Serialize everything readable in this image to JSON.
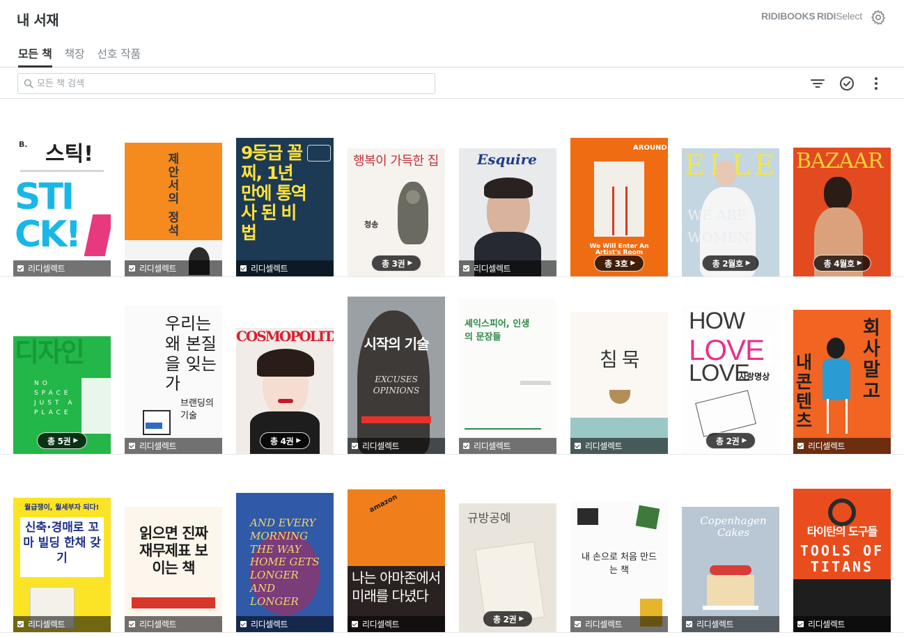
{
  "header": {
    "title": "내 서재",
    "brand_ridibooks": "RIDIBOOKS",
    "brand_ridi": "RIDI",
    "brand_select": "Select"
  },
  "tabs": [
    {
      "label": "모든 책",
      "active": true
    },
    {
      "label": "책장",
      "active": false
    },
    {
      "label": "선호 작품",
      "active": false
    }
  ],
  "search": {
    "placeholder": "모든 책 검색",
    "value": ""
  },
  "icons": {
    "settings": "gear-icon",
    "filter": "filter-icon",
    "select": "check-circle-icon",
    "more": "more-vertical-icon",
    "search": "search-icon"
  },
  "badge_label": "리디셀렉트",
  "books": [
    {
      "badge": "리디셀렉트",
      "count": "",
      "cover_text": "스틱!",
      "cover_sub": "STICK!"
    },
    {
      "badge": "리디셀렉트",
      "count": "",
      "cover_text": "제안서의 정석",
      "cover_sub": ""
    },
    {
      "badge": "리디셀렉트",
      "count": "",
      "cover_text": "9등급 꼴찌, 1년 만에 통역사 된 비법",
      "cover_sub": ""
    },
    {
      "badge": "",
      "count": "총 3권",
      "cover_text": "행복이 가득한 집",
      "cover_sub": "청송"
    },
    {
      "badge": "리디셀렉트",
      "count": "",
      "cover_text": "Esquire",
      "cover_sub": ""
    },
    {
      "badge": "",
      "count": "총 3호",
      "cover_text": "AROUND",
      "cover_sub": "We Will Enter An Artist's Room"
    },
    {
      "badge": "",
      "count": "총 2월호",
      "cover_text": "ELLE",
      "cover_sub": "WE ARE WOMEN"
    },
    {
      "badge": "",
      "count": "총 4월호",
      "cover_text": "BAZAAR",
      "cover_sub": ""
    },
    {
      "badge": "",
      "count": "총 5권",
      "cover_text": "디자인",
      "cover_sub": "NO SPACE JUST A PLACE"
    },
    {
      "badge": "리디셀렉트",
      "count": "",
      "cover_text": "우리는 왜 본질을 잊는가",
      "cover_sub": "브랜딩의 기술"
    },
    {
      "badge": "",
      "count": "총 4권",
      "cover_text": "COSMOPOLITAN",
      "cover_sub": ""
    },
    {
      "badge": "리디셀렉트",
      "count": "",
      "cover_text": "시작의 기술",
      "cover_sub": "EXCUSES OPINIONS"
    },
    {
      "badge": "리디셀렉트",
      "count": "",
      "cover_text": "셰익스피어, 인생의 문장들",
      "cover_sub": ""
    },
    {
      "badge": "리디셀렉트",
      "count": "",
      "cover_text": "침묵",
      "cover_sub": ""
    },
    {
      "badge": "",
      "count": "총 2권",
      "cover_text": "HOW TO LOVE",
      "cover_sub": "사랑명상"
    },
    {
      "badge": "리디셀렉트",
      "count": "",
      "cover_text": "회사 말고 내 콘텐츠",
      "cover_sub": ""
    },
    {
      "badge": "리디셀렉트",
      "count": "",
      "cover_text": "신축·경매로 꼬마 빌딩 한채 갖기",
      "cover_sub": "월급쟁이, 월세부자 되다!"
    },
    {
      "badge": "리디셀렉트",
      "count": "",
      "cover_text": "읽으면 진짜 재무제표 보이는 책",
      "cover_sub": ""
    },
    {
      "badge": "리디셀렉트",
      "count": "",
      "cover_text": "AND EVERY MORNING THE WAY HOME GETS LONGER AND LONGER",
      "cover_sub": ""
    },
    {
      "badge": "리디셀렉트",
      "count": "",
      "cover_text": "나는 아마존에서 미래를 다녔다",
      "cover_sub": "amazon"
    },
    {
      "badge": "",
      "count": "총 2권",
      "cover_text": "규방공예",
      "cover_sub": ""
    },
    {
      "badge": "리디셀렉트",
      "count": "",
      "cover_text": "내 손으로 처음 만드는 책",
      "cover_sub": ""
    },
    {
      "badge": "리디셀렉트",
      "count": "",
      "cover_text": "Copenhagen Cakes",
      "cover_sub": ""
    },
    {
      "badge": "리디셀렉트",
      "count": "",
      "cover_text": "타이탄의 도구들",
      "cover_sub": "TOOLS OF TITANS"
    }
  ],
  "colors": {
    "accent_dark": "#303538",
    "tab_inactive": "#808991",
    "divider": "#d6d9dc"
  }
}
